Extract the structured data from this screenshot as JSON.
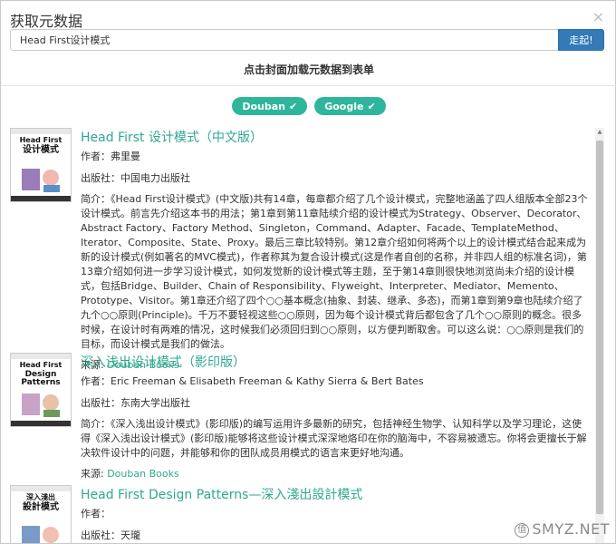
{
  "dialog": {
    "title": "获取元数据",
    "close_label": "×",
    "search_value": "Head First设计模式",
    "go_label": "走起!",
    "hint": "点击封面加载元数据到表单"
  },
  "sources": [
    {
      "label": "Douban",
      "icon": "check-icon"
    },
    {
      "label": "Google",
      "icon": "check-icon"
    }
  ],
  "labels": {
    "author": "作者：",
    "publisher": "出版社：",
    "summary": "简介：",
    "source": "来源: "
  },
  "results": [
    {
      "title": "Head First 设计模式（中文版）",
      "author": "弗里曼",
      "publisher": "中国电力出版社",
      "summary": "《Head First设计模式》(中文版)共有14章，每章都介绍了几个设计模式，完整地涵盖了四人组版本全部23个设计模式。前言先介绍这本书的用法；第1章到第11章陆续介绍的设计模式为Strategy、Observer、Decorator、Abstract Factory、Factory Method、Singleton，Command、Adapter、Facade、TemplateMethod、Iterator、Composite、State、Proxy。最后三章比较特别。第12章介绍如何将两个以上的设计模式结合起来成为新的设计模式(例如著名的MVC模式)，作者称其为复合设计模式(这是作者自创的名称，并非四人组的标准名词)，第13章介绍如何进一步学习设计模式，如何发觉新的设计模式等主题，至于第14章则很快地浏览尚未介绍的设计模式，包括Bridge、Builder、Chain of Responsibility、Flyweight、Interpreter、Mediator、Memento、Prototype、Visitor。第1章还介绍了四个○○基本概念(抽象、封装、继承、多态)，而第1章到第9章也陆续介绍了九个○○原则(Principle)。千万不要轻视这些○○原则，因为每个设计模式背后都包含了几个○○原则的概念。很多时候，在设计时有两难的情况，这时候我们必须回归到○○原则，以方便判断取舍。可以这么说：○○原则是我们的目标，而设计模式是我们的做法。",
      "source": "Douban Books",
      "cover_text": [
        "Head First",
        "设计模式"
      ]
    },
    {
      "title": "深入浅出设计模式（影印版）",
      "author": "Eric Freeman & Elisabeth Freeman & Kathy Sierra & Bert Bates",
      "publisher": "东南大学出版社",
      "summary": "《深入浅出设计模式》(影印版)的编写运用许多最新的研究，包括神经生物学、认知科学以及学习理论，这使得《深入浅出设计模式》(影印版)能够将这些设计模式深深地烙印在你的脑海中，不容易被遗忘。你将会更擅长于解决软件设计中的问题，并能够和你的团队成员用模式的语言来更好地沟通。",
      "source": "Douban Books",
      "cover_text": [
        "Head First",
        "Design Patterns"
      ]
    },
    {
      "title": "Head First Design Patterns—深入淺出設計模式",
      "author": "",
      "publisher": "天瓏",
      "cover_text": [
        "深入淺出",
        "設計模式"
      ]
    }
  ],
  "watermark": "SMYZ.NET",
  "colors": {
    "accent": "#2fb59c",
    "link": "#2fa88f",
    "primary_button": "#337ab7"
  }
}
